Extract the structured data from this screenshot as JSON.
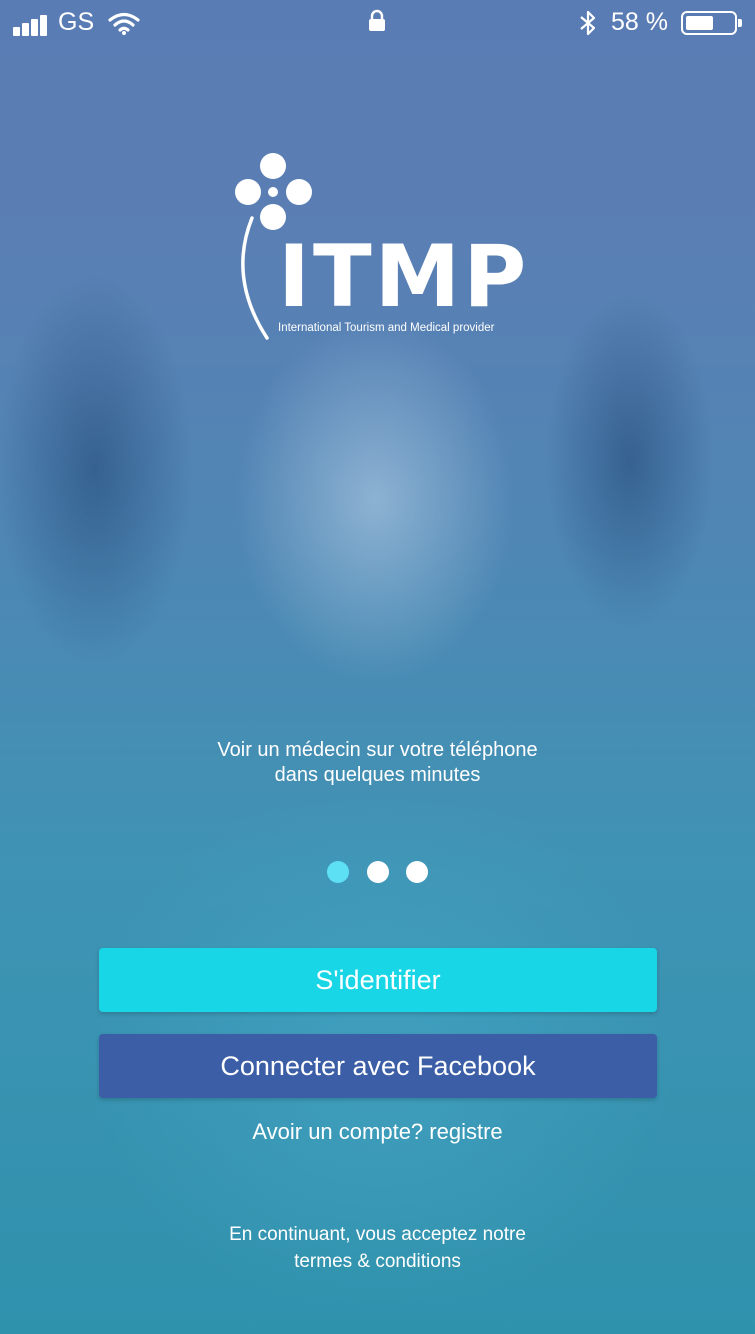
{
  "status_bar": {
    "carrier": "GS",
    "battery_percent": "58 %",
    "battery_level": 0.58,
    "icons": [
      "signal-icon",
      "wifi-icon",
      "lock-icon",
      "bluetooth-icon",
      "battery-icon"
    ]
  },
  "logo": {
    "wordmark": "ITMP",
    "tagline": "International Tourism and Medical provider"
  },
  "intro": {
    "line1": "Voir un médecin sur votre téléphone",
    "line2": "dans quelques minutes"
  },
  "carousel": {
    "page_count": 3,
    "active_index": 0
  },
  "buttons": {
    "login_label": "S'identifier",
    "facebook_label": "Connecter avec Facebook"
  },
  "register_link": "Avoir un compte? registre",
  "terms": {
    "line1": "En continuant, vous acceptez notre",
    "line2": "termes & conditions"
  },
  "colors": {
    "accent": "#19d6e6",
    "facebook": "#3b5ea7",
    "active_dot": "#5ee0f4"
  }
}
